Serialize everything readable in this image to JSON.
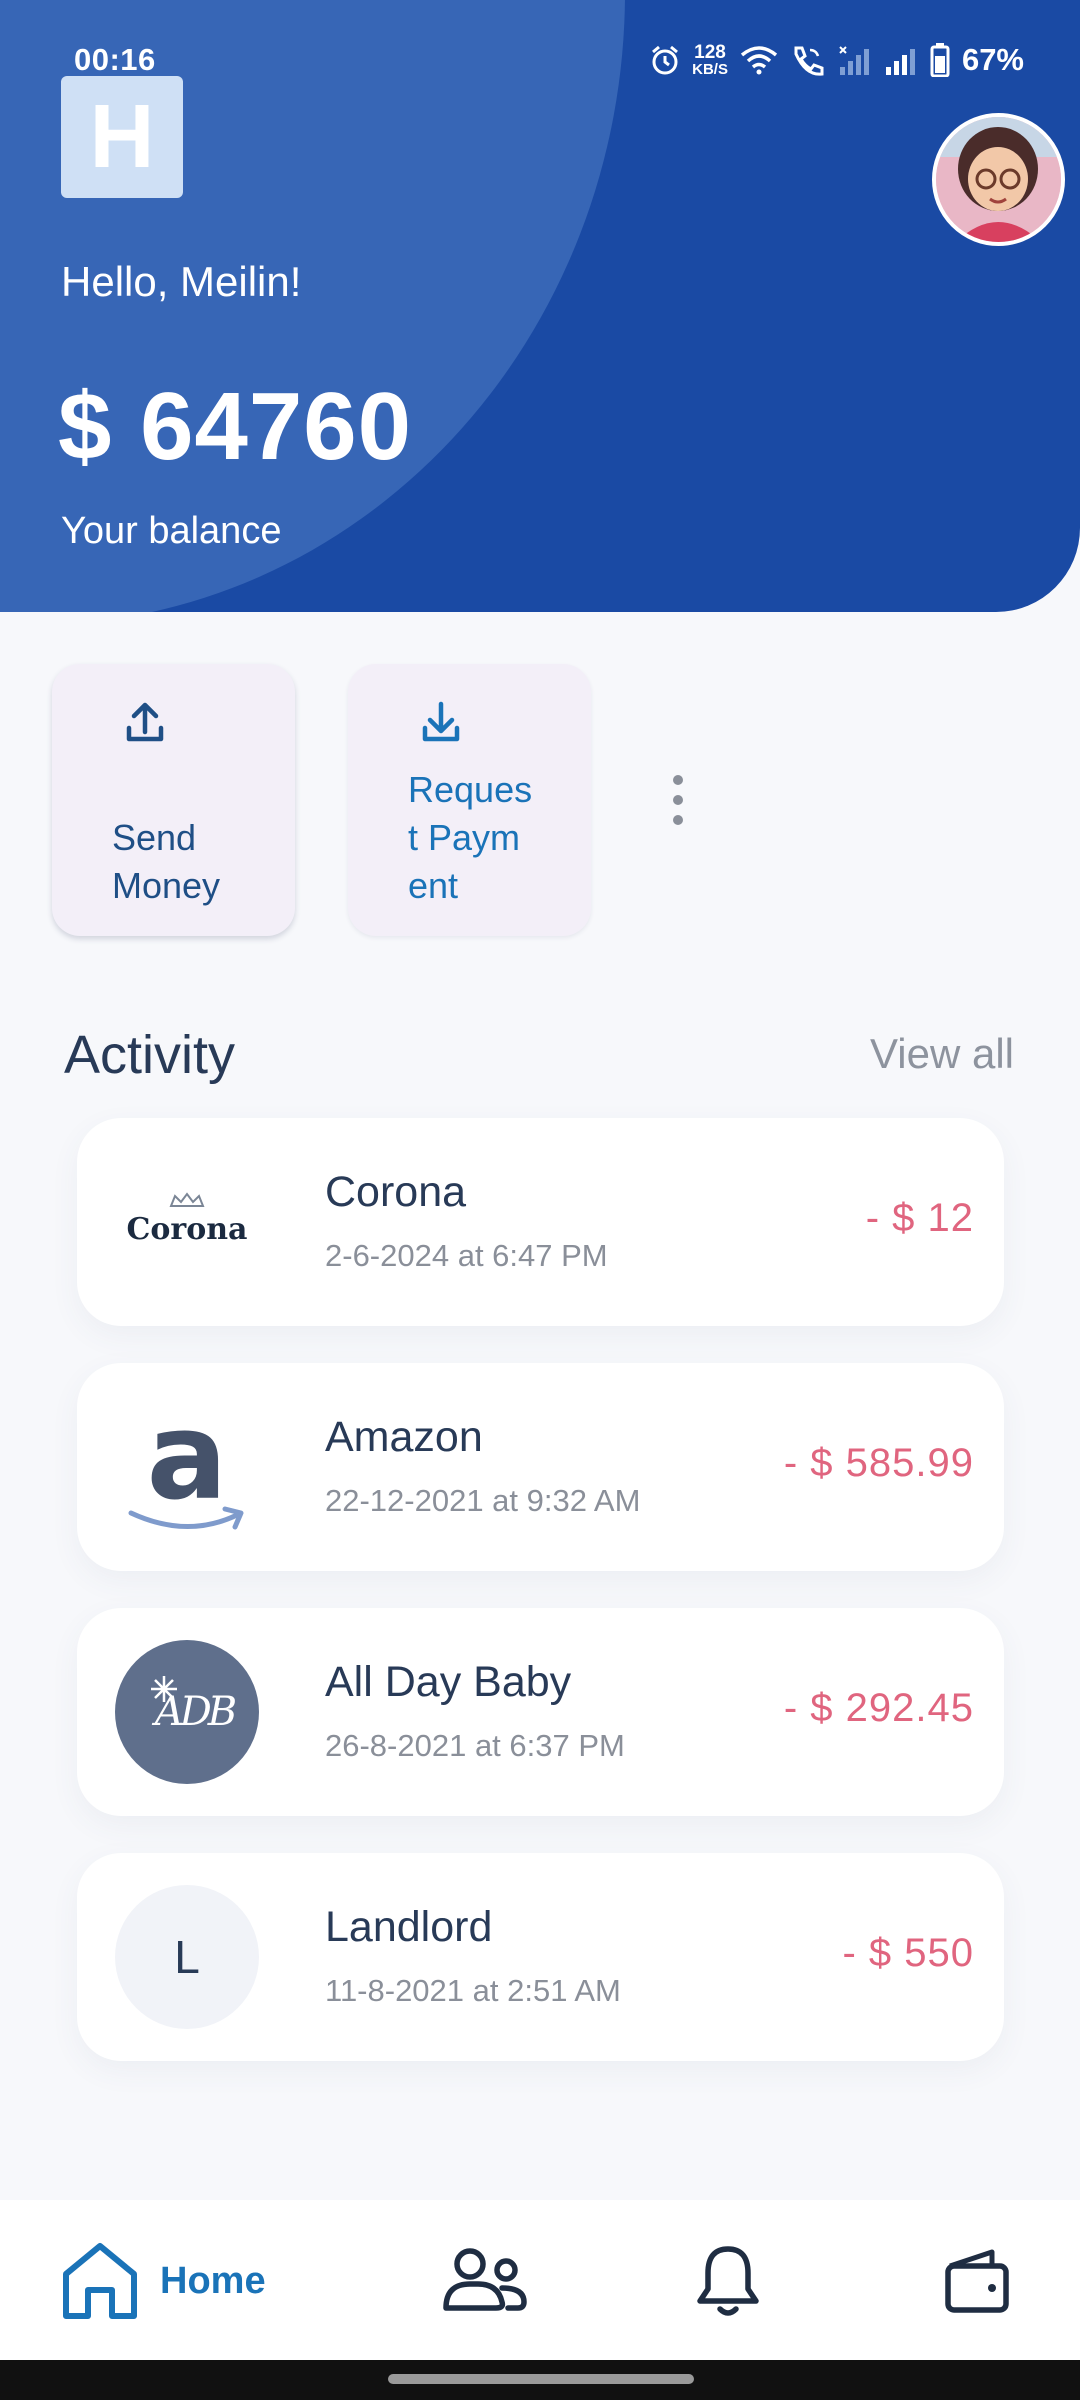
{
  "status_bar": {
    "time": "00:16",
    "net_speed_value": "128",
    "net_speed_unit": "KB/S",
    "battery": "67%"
  },
  "header": {
    "logo_letter": "H",
    "greeting": "Hello, Meilin!",
    "balance": "$ 64760",
    "balance_label": "Your balance"
  },
  "actions": {
    "send_label": "Send Money",
    "request_label": "Request Payment"
  },
  "activity": {
    "title": "Activity",
    "view_all": "View all",
    "transactions": [
      {
        "name": "Corona",
        "logo_text": "Corona",
        "date": "2-6-2024 at 6:47 PM",
        "amount": "- $ 12"
      },
      {
        "name": "Amazon",
        "logo_text": "a",
        "date": "22-12-2021 at 9:32 AM",
        "amount": "- $ 585.99"
      },
      {
        "name": "All Day Baby",
        "logo_text": "ADB",
        "date": "26-8-2021 at 6:37 PM",
        "amount": "- $ 292.45"
      },
      {
        "name": "Landlord",
        "logo_text": "L",
        "date": "11-8-2021 at 2:51 AM",
        "amount": "- $ 550"
      }
    ]
  },
  "nav": {
    "home_label": "Home",
    "items": [
      "home-icon",
      "people-icon",
      "bell-icon",
      "wallet-icon"
    ]
  },
  "colors": {
    "header_blue": "#1a4aa4",
    "header_light": "#3766b6",
    "accent": "#1a73b8",
    "amount_red": "#e0657f"
  }
}
